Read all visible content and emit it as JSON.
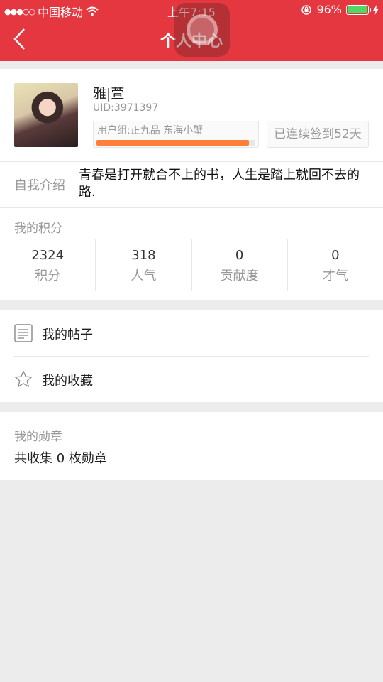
{
  "status_bar": {
    "carrier": "中国移动",
    "time": "上午7:15",
    "battery_percent": "96%",
    "battery_level": 0.96
  },
  "nav": {
    "title": "个人中心",
    "back_icon": "chevron-left-icon"
  },
  "profile": {
    "username": "雅|萱",
    "uid": "UID:3971397",
    "usergroup": "用户组:正九品   东海小蟹",
    "level_progress": 0.96,
    "signin_text": "已连续签到52天",
    "intro_label": "自我介绍",
    "intro_text": "青春是打开就合不上的书，人生是踏上就回不去的路."
  },
  "scores": {
    "title": "我的积分",
    "items": [
      {
        "value": "2324",
        "label": "积分"
      },
      {
        "value": "318",
        "label": "人气"
      },
      {
        "value": "0",
        "label": "贡献度"
      },
      {
        "value": "0",
        "label": "才气"
      }
    ]
  },
  "menu": {
    "items": [
      {
        "label": "我的帖子",
        "icon": "document-icon"
      },
      {
        "label": "我的收藏",
        "icon": "star-icon"
      }
    ]
  },
  "medals": {
    "title": "我的勋章",
    "count_text": "共收集 0 枚勋章"
  },
  "colors": {
    "header": "#e5373f",
    "progress": "#ff7e3a",
    "battery": "#4cd964"
  }
}
